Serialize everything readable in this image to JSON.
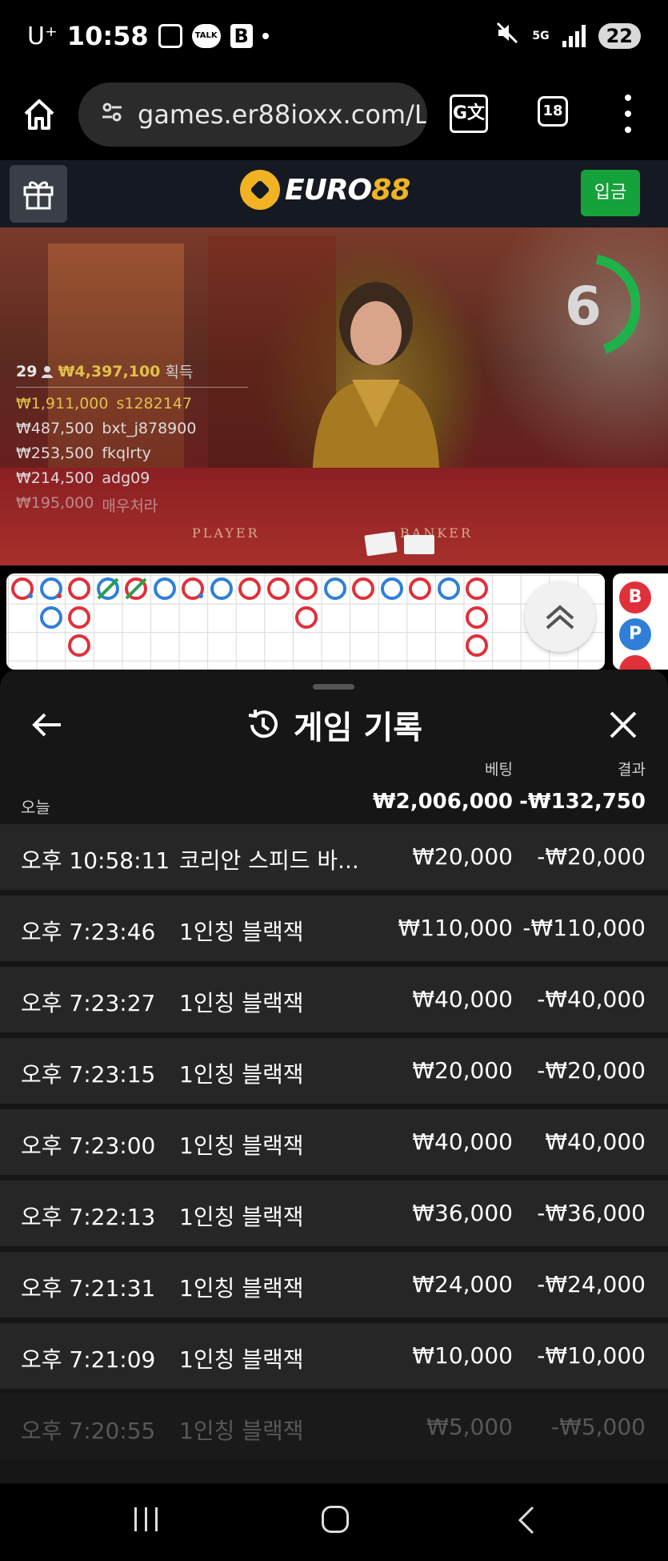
{
  "status_bar": {
    "carrier": "U⁺",
    "time": "10:58",
    "network": "5G",
    "battery": "22"
  },
  "browser": {
    "url": "games.er88ioxx.com/Lau",
    "tab_count": "18"
  },
  "site_header": {
    "logo_word": "EURO",
    "logo_num": "88",
    "deposit_label": "입금"
  },
  "video": {
    "timer": "6",
    "winners": {
      "count": "29",
      "total": "₩4,397,100",
      "total_label": "획득",
      "entries": [
        {
          "amount": "₩1,911,000",
          "user": "s1282147"
        },
        {
          "amount": "₩487,500",
          "user": "bxt_j878900"
        },
        {
          "amount": "₩253,500",
          "user": "fkqlrty"
        },
        {
          "amount": "₩214,500",
          "user": "adg09"
        },
        {
          "amount": "₩195,000",
          "user": "매우처라"
        }
      ]
    },
    "table_player": "PLAYER",
    "table_banker": "BANKER"
  },
  "side_road": {
    "banker": "B",
    "player": "P"
  },
  "game_history": {
    "title": "게임 기록",
    "bet_header": "베팅",
    "result_header": "결과",
    "today_label": "오늘",
    "total_bet": "₩2,006,000",
    "total_result": "-₩132,750",
    "rows": [
      {
        "time": "오후 10:58:11",
        "game": "코리안 스피드 바...",
        "bet": "₩20,000",
        "result": "-₩20,000"
      },
      {
        "time": "오후 7:23:46",
        "game": "1인칭 블랙잭",
        "bet": "₩110,000",
        "result": "-₩110,000"
      },
      {
        "time": "오후 7:23:27",
        "game": "1인칭 블랙잭",
        "bet": "₩40,000",
        "result": "-₩40,000"
      },
      {
        "time": "오후 7:23:15",
        "game": "1인칭 블랙잭",
        "bet": "₩20,000",
        "result": "-₩20,000"
      },
      {
        "time": "오후 7:23:00",
        "game": "1인칭 블랙잭",
        "bet": "₩40,000",
        "result": "₩40,000"
      },
      {
        "time": "오후 7:22:13",
        "game": "1인칭 블랙잭",
        "bet": "₩36,000",
        "result": "-₩36,000"
      },
      {
        "time": "오후 7:21:31",
        "game": "1인칭 블랙잭",
        "bet": "₩24,000",
        "result": "-₩24,000"
      },
      {
        "time": "오후 7:21:09",
        "game": "1인칭 블랙잭",
        "bet": "₩10,000",
        "result": "-₩10,000"
      },
      {
        "time": "오후 7:20:55",
        "game": "1인칭 블랙잭",
        "bet": "₩5,000",
        "result": "-₩5,000"
      }
    ]
  },
  "colors": {
    "banker_red": "#e0303a",
    "player_blue": "#2f7fd8",
    "tie_green": "#27a04a",
    "deposit_green": "#16a23a",
    "logo_gold": "#f0b323"
  }
}
